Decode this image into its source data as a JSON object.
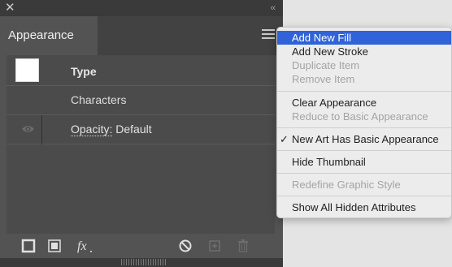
{
  "panel": {
    "tab_label": "Appearance",
    "close_icon": "close-icon",
    "collapse_glyph": "‹‹",
    "rows": {
      "type_label": "Type",
      "characters_label": "Characters",
      "opacity_name": "Opacity:",
      "opacity_value": " Default"
    },
    "bottom_icons": [
      "add-stroke-icon",
      "add-fill-icon",
      "fx-icon",
      "clear-appearance-icon",
      "duplicate-item-icon",
      "delete-icon"
    ],
    "fx_label": "fx"
  },
  "menu": {
    "items": [
      {
        "label": "Add New Fill",
        "state": "highlighted"
      },
      {
        "label": "Add New Stroke",
        "state": "enabled"
      },
      {
        "label": "Duplicate Item",
        "state": "disabled"
      },
      {
        "label": "Remove Item",
        "state": "disabled"
      },
      {
        "label": "Clear Appearance",
        "state": "enabled"
      },
      {
        "label": "Reduce to Basic Appearance",
        "state": "disabled"
      },
      {
        "label": "New Art Has Basic Appearance",
        "state": "checked"
      },
      {
        "label": "Hide Thumbnail",
        "state": "enabled"
      },
      {
        "label": "Redefine Graphic Style",
        "state": "disabled"
      },
      {
        "label": "Show All Hidden Attributes",
        "state": "enabled"
      }
    ],
    "check_glyph": "✓"
  },
  "colors": {
    "panel_bg": "#535353",
    "menu_bg": "#ececec",
    "highlight": "#2f63d7"
  }
}
